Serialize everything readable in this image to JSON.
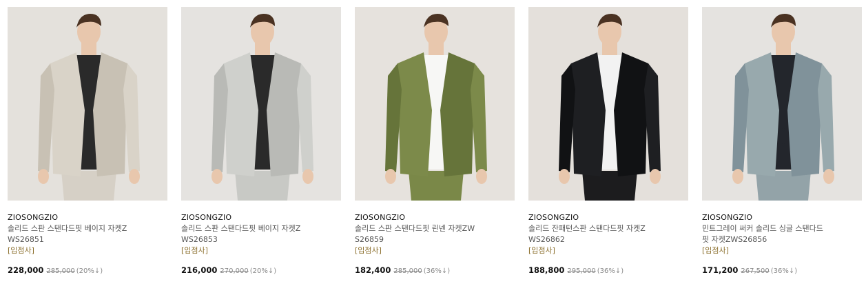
{
  "products": [
    {
      "brand": "ZIOSONGZIO",
      "name": "솔리드 스판 스탠다드핏 베이지 자켓ZWS26851",
      "tag": "[입점사]",
      "price": "228,000",
      "original_price": "285,000",
      "discount": "(20%↓)",
      "colors": {
        "bg": "#e4e1dc",
        "jacket": "#d9d3c8",
        "jacket_shade": "#c8c1b4",
        "shirt": "#2a2a2a",
        "pants": "#d6d0c6",
        "skin": "#e8c7ad",
        "hair": "#4a3222"
      }
    },
    {
      "brand": "ZIOSONGZIO",
      "name": "솔리드 스판 스탠다드핏 베이지 자켓ZWS26853",
      "tag": "[입점사]",
      "price": "216,000",
      "original_price": "270,000",
      "discount": "(20%↓)",
      "colors": {
        "bg": "#e5e3e0",
        "jacket": "#cfd0cc",
        "jacket_shade": "#b9bab6",
        "shirt": "#2a2a2a",
        "pants": "#c8c9c5",
        "skin": "#e8c7ad",
        "hair": "#4a3222"
      }
    },
    {
      "brand": "ZIOSONGZIO",
      "name": "솔리드 스판 스탠다드핏 린넨 자켓ZWS26859",
      "tag": "[입점사]",
      "price": "182,400",
      "original_price": "285,000",
      "discount": "(36%↓)",
      "colors": {
        "bg": "#e6e2dd",
        "jacket": "#7c8a4a",
        "jacket_shade": "#66743a",
        "shirt": "#f7f7f5",
        "pants": "#7a8848",
        "skin": "#e8c7ad",
        "hair": "#4a3222"
      }
    },
    {
      "brand": "ZIOSONGZIO",
      "name": "솔리드 잔패턴스판 스탠다드핏 자켓ZWS26862",
      "tag": "[입점사]",
      "price": "188,800",
      "original_price": "295,000",
      "discount": "(36%↓)",
      "colors": {
        "bg": "#e4e0db",
        "jacket": "#1e1f22",
        "jacket_shade": "#111214",
        "shirt": "#f2f2f2",
        "pants": "#1c1c1e",
        "skin": "#e8c7ad",
        "hair": "#4a3222"
      }
    },
    {
      "brand": "ZIOSONGZIO",
      "name": "민트그레이 써커 솔리드 싱글 스탠다드핏 자켓ZWS26856",
      "tag": "[입점사]",
      "price": "171,200",
      "original_price": "267,500",
      "discount": "(36%↓)",
      "colors": {
        "bg": "#e5e3e0",
        "jacket": "#98a9ad",
        "jacket_shade": "#80929a",
        "shirt": "#23262c",
        "pants": "#93a3a8",
        "skin": "#e8c7ad",
        "hair": "#4a3222"
      }
    }
  ]
}
